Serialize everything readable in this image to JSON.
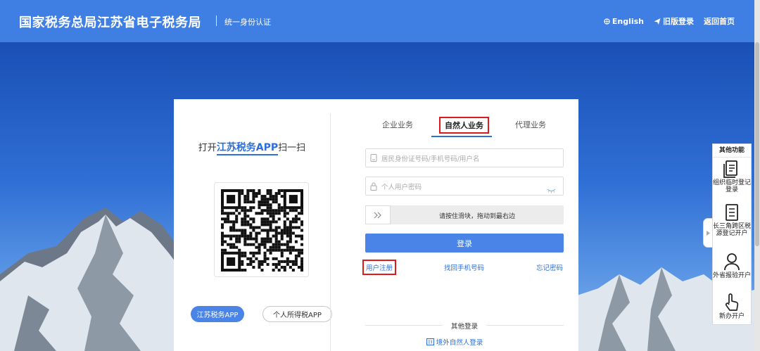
{
  "header": {
    "title": "国家税务总局江苏省电子税务局",
    "subtitle": "统一身份认证",
    "nav": {
      "english": "English",
      "old_login": "旧版登录",
      "home": "返回首页"
    }
  },
  "left": {
    "scan_prefix": "打开",
    "scan_app": "江苏税务APP",
    "scan_suffix": "扫一扫",
    "app_buttons": [
      "江苏税务APP",
      "个人所得税APP"
    ]
  },
  "tabs": [
    "企业业务",
    "自然人业务",
    "代理业务"
  ],
  "active_tab": "自然人业务",
  "form": {
    "account_placeholder": "居民身份证号码/手机号码/用户名",
    "password_placeholder": "个人用户密码",
    "slider_text": "请按住滑块，拖动到最右边",
    "login_label": "登录"
  },
  "links": {
    "register": "用户注册",
    "find_phone": "找回手机号码",
    "forgot_password": "忘记密码"
  },
  "other_login": {
    "heading": "其他登录",
    "overseas": "境外自然人登录"
  },
  "side_panel": {
    "title": "其他功能",
    "items": [
      "组织临时登记登录",
      "长三角跨区税源登记开户",
      "外省报验开户",
      "新办开户"
    ]
  },
  "colors": {
    "header_bg": "#3f7fe3",
    "accent": "#4a84e6",
    "highlight_border": "#e01a1a"
  }
}
